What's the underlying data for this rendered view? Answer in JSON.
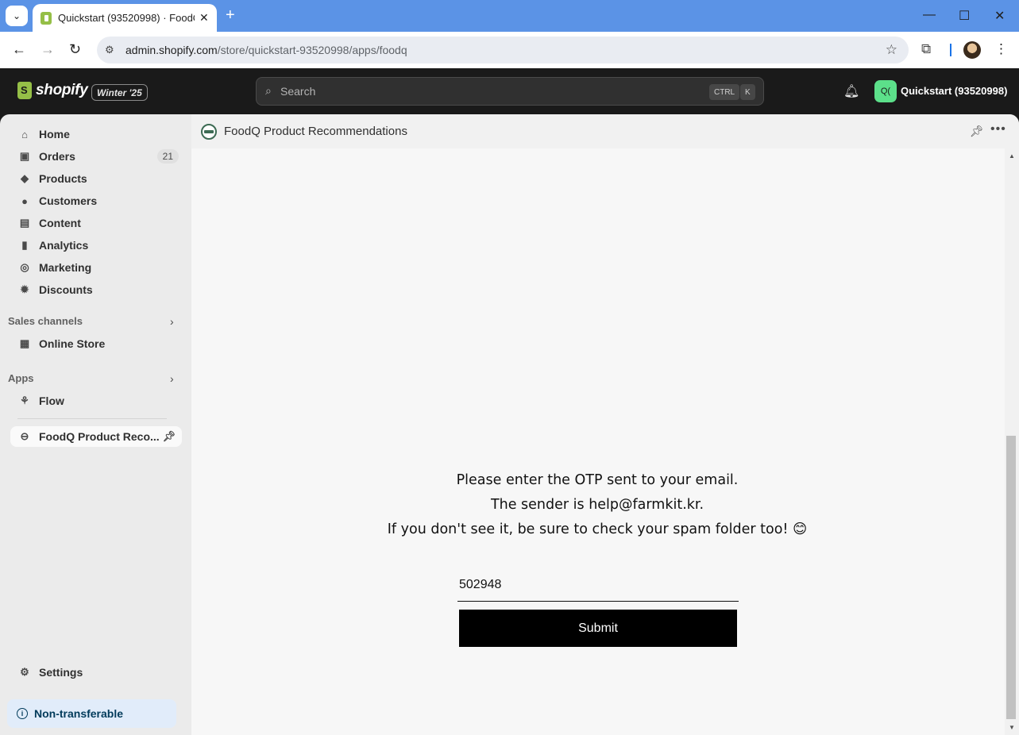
{
  "browser": {
    "tab_title": "Quickstart (93520998) · FoodQ",
    "url_host": "admin.shopify.com",
    "url_path": "/store/quickstart-93520998/apps/foodq"
  },
  "topbar": {
    "logo_text": "shopify",
    "edition_badge": "Winter '25",
    "search_placeholder": "Search",
    "shortcut_key1": "CTRL",
    "shortcut_key2": "K",
    "store_initials": "Q(",
    "store_name": "Quickstart (93520998)"
  },
  "sidebar": {
    "items": [
      {
        "label": "Home",
        "icon": "home-icon"
      },
      {
        "label": "Orders",
        "icon": "orders-icon",
        "badge": "21"
      },
      {
        "label": "Products",
        "icon": "tag-icon"
      },
      {
        "label": "Customers",
        "icon": "person-icon"
      },
      {
        "label": "Content",
        "icon": "image-icon"
      },
      {
        "label": "Analytics",
        "icon": "bar-chart-icon"
      },
      {
        "label": "Marketing",
        "icon": "target-icon"
      },
      {
        "label": "Discounts",
        "icon": "discount-icon"
      }
    ],
    "sales_channels_heading": "Sales channels",
    "online_store": "Online Store",
    "apps_heading": "Apps",
    "flow": "Flow",
    "pinned_app": "FoodQ Product Reco...",
    "settings": "Settings",
    "non_transferable": "Non-transferable"
  },
  "main": {
    "app_title": "FoodQ Product Recommendations",
    "otp_line1": "Please enter the OTP sent to your email.",
    "otp_line2": "The sender is help@farmkit.kr.",
    "otp_line3": "If you don't see it, be sure to check your spam folder too! 😊",
    "otp_value": "502948",
    "submit_label": "Submit"
  }
}
